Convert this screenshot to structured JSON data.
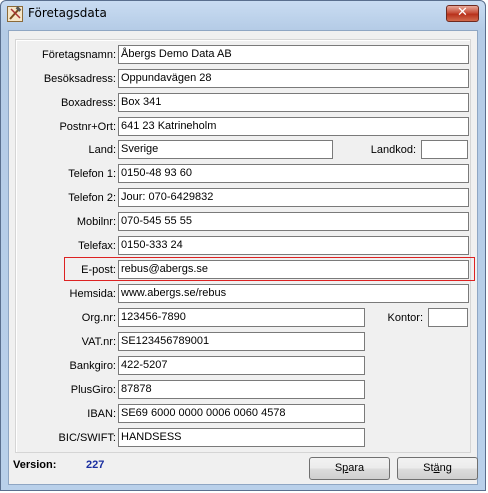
{
  "window": {
    "title": "Företagsdata",
    "close_symbol": "✕"
  },
  "icons": {
    "app": "hammer-tools-icon",
    "close": "close-icon"
  },
  "form": {
    "foretagsnamn": {
      "label": "Företagsnamn:",
      "value": "Åbergs Demo Data AB"
    },
    "besoksadress": {
      "label": "Besöksadress:",
      "value": "Oppundavägen 28"
    },
    "boxadress": {
      "label": "Boxadress:",
      "value": "Box 341"
    },
    "postnr_ort": {
      "label": "Postnr+Ort:",
      "value": "641 23  Katrineholm"
    },
    "land": {
      "label": "Land:",
      "value": "Sverige"
    },
    "landkod": {
      "label": "Landkod:",
      "value": ""
    },
    "telefon1": {
      "label": "Telefon 1:",
      "value": "0150-48 93 60"
    },
    "telefon2": {
      "label": "Telefon 2:",
      "value": "Jour: 070-6429832"
    },
    "mobilnr": {
      "label": "Mobilnr:",
      "value": "070-545 55 55"
    },
    "telefax": {
      "label": "Telefax:",
      "value": "0150-333 24"
    },
    "epost": {
      "label": "E-post:",
      "value": "rebus@abergs.se"
    },
    "hemsida": {
      "label": "Hemsida:",
      "value": "www.abergs.se/rebus"
    },
    "orgnr": {
      "label": "Org.nr:",
      "value": "123456-7890"
    },
    "kontor": {
      "label": "Kontor:",
      "value": ""
    },
    "vatnr": {
      "label": "VAT.nr:",
      "value": "SE123456789001"
    },
    "bankgiro": {
      "label": "Bankgiro:",
      "value": "422-5207"
    },
    "plusgiro": {
      "label": "PlusGiro:",
      "value": "87878"
    },
    "iban": {
      "label": "IBAN:",
      "value": "SE69 6000 0000 0006 0060 4578"
    },
    "bic": {
      "label": "BIC/SWIFT:",
      "value": "HANDSESS"
    }
  },
  "footer": {
    "version_label": "Version:",
    "version_value": "227",
    "save_pre": "S",
    "save_key": "p",
    "save_post": "ara",
    "close_pre": "St",
    "close_key": "ä",
    "close_post": "ng"
  },
  "colors": {
    "highlight": "#dd2222",
    "version": "#1a2fa0",
    "close_button": "#c7503b"
  }
}
